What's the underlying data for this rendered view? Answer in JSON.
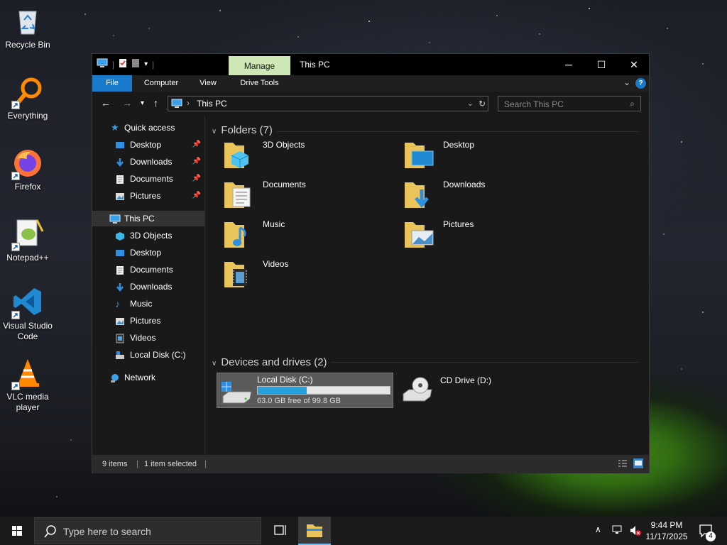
{
  "desktop": {
    "icons": [
      {
        "label": "Recycle Bin",
        "icon": "recycle-bin-icon"
      },
      {
        "label": "Everything",
        "icon": "everything-search-icon"
      },
      {
        "label": "Firefox",
        "icon": "firefox-icon"
      },
      {
        "label": "Notepad++",
        "icon": "notepad-plus-plus-icon"
      },
      {
        "label": "Visual Studio Code",
        "icon": "vscode-icon"
      },
      {
        "label": "VLC media player",
        "icon": "vlc-icon"
      }
    ]
  },
  "window": {
    "title": "This PC",
    "manage_tab": "Manage",
    "ribbon_tabs": [
      "File",
      "Computer",
      "View",
      "Drive Tools"
    ],
    "help_label": "?",
    "address": "This PC",
    "search_placeholder": "Search This PC",
    "nav_pane": {
      "quick_access": "Quick access",
      "quick_items": [
        "Desktop",
        "Downloads",
        "Documents",
        "Pictures"
      ],
      "this_pc": "This PC",
      "this_pc_items": [
        "3D Objects",
        "Desktop",
        "Documents",
        "Downloads",
        "Music",
        "Pictures",
        "Videos",
        "Local Disk (C:)"
      ],
      "network": "Network"
    },
    "content": {
      "folders_header": "Folders (7)",
      "folders": [
        "3D Objects",
        "Desktop",
        "Documents",
        "Downloads",
        "Music",
        "Pictures",
        "Videos"
      ],
      "devices_header": "Devices and drives (2)",
      "drives": [
        {
          "name": "Local Disk (C:)",
          "free": "63.0 GB free of 99.8 GB",
          "used_fraction": 0.369
        },
        {
          "name": "CD Drive (D:)"
        }
      ]
    },
    "status": {
      "items": "9 items",
      "selected": "1 item selected"
    }
  },
  "taskbar": {
    "search_placeholder": "Type here to search",
    "time": "9:44 PM",
    "date": "11/17/2025",
    "notification_count": "4"
  },
  "colors": {
    "accent": "#1979ca",
    "manage_tab": "#cde8b5",
    "drive_fill": "#26a0da"
  }
}
